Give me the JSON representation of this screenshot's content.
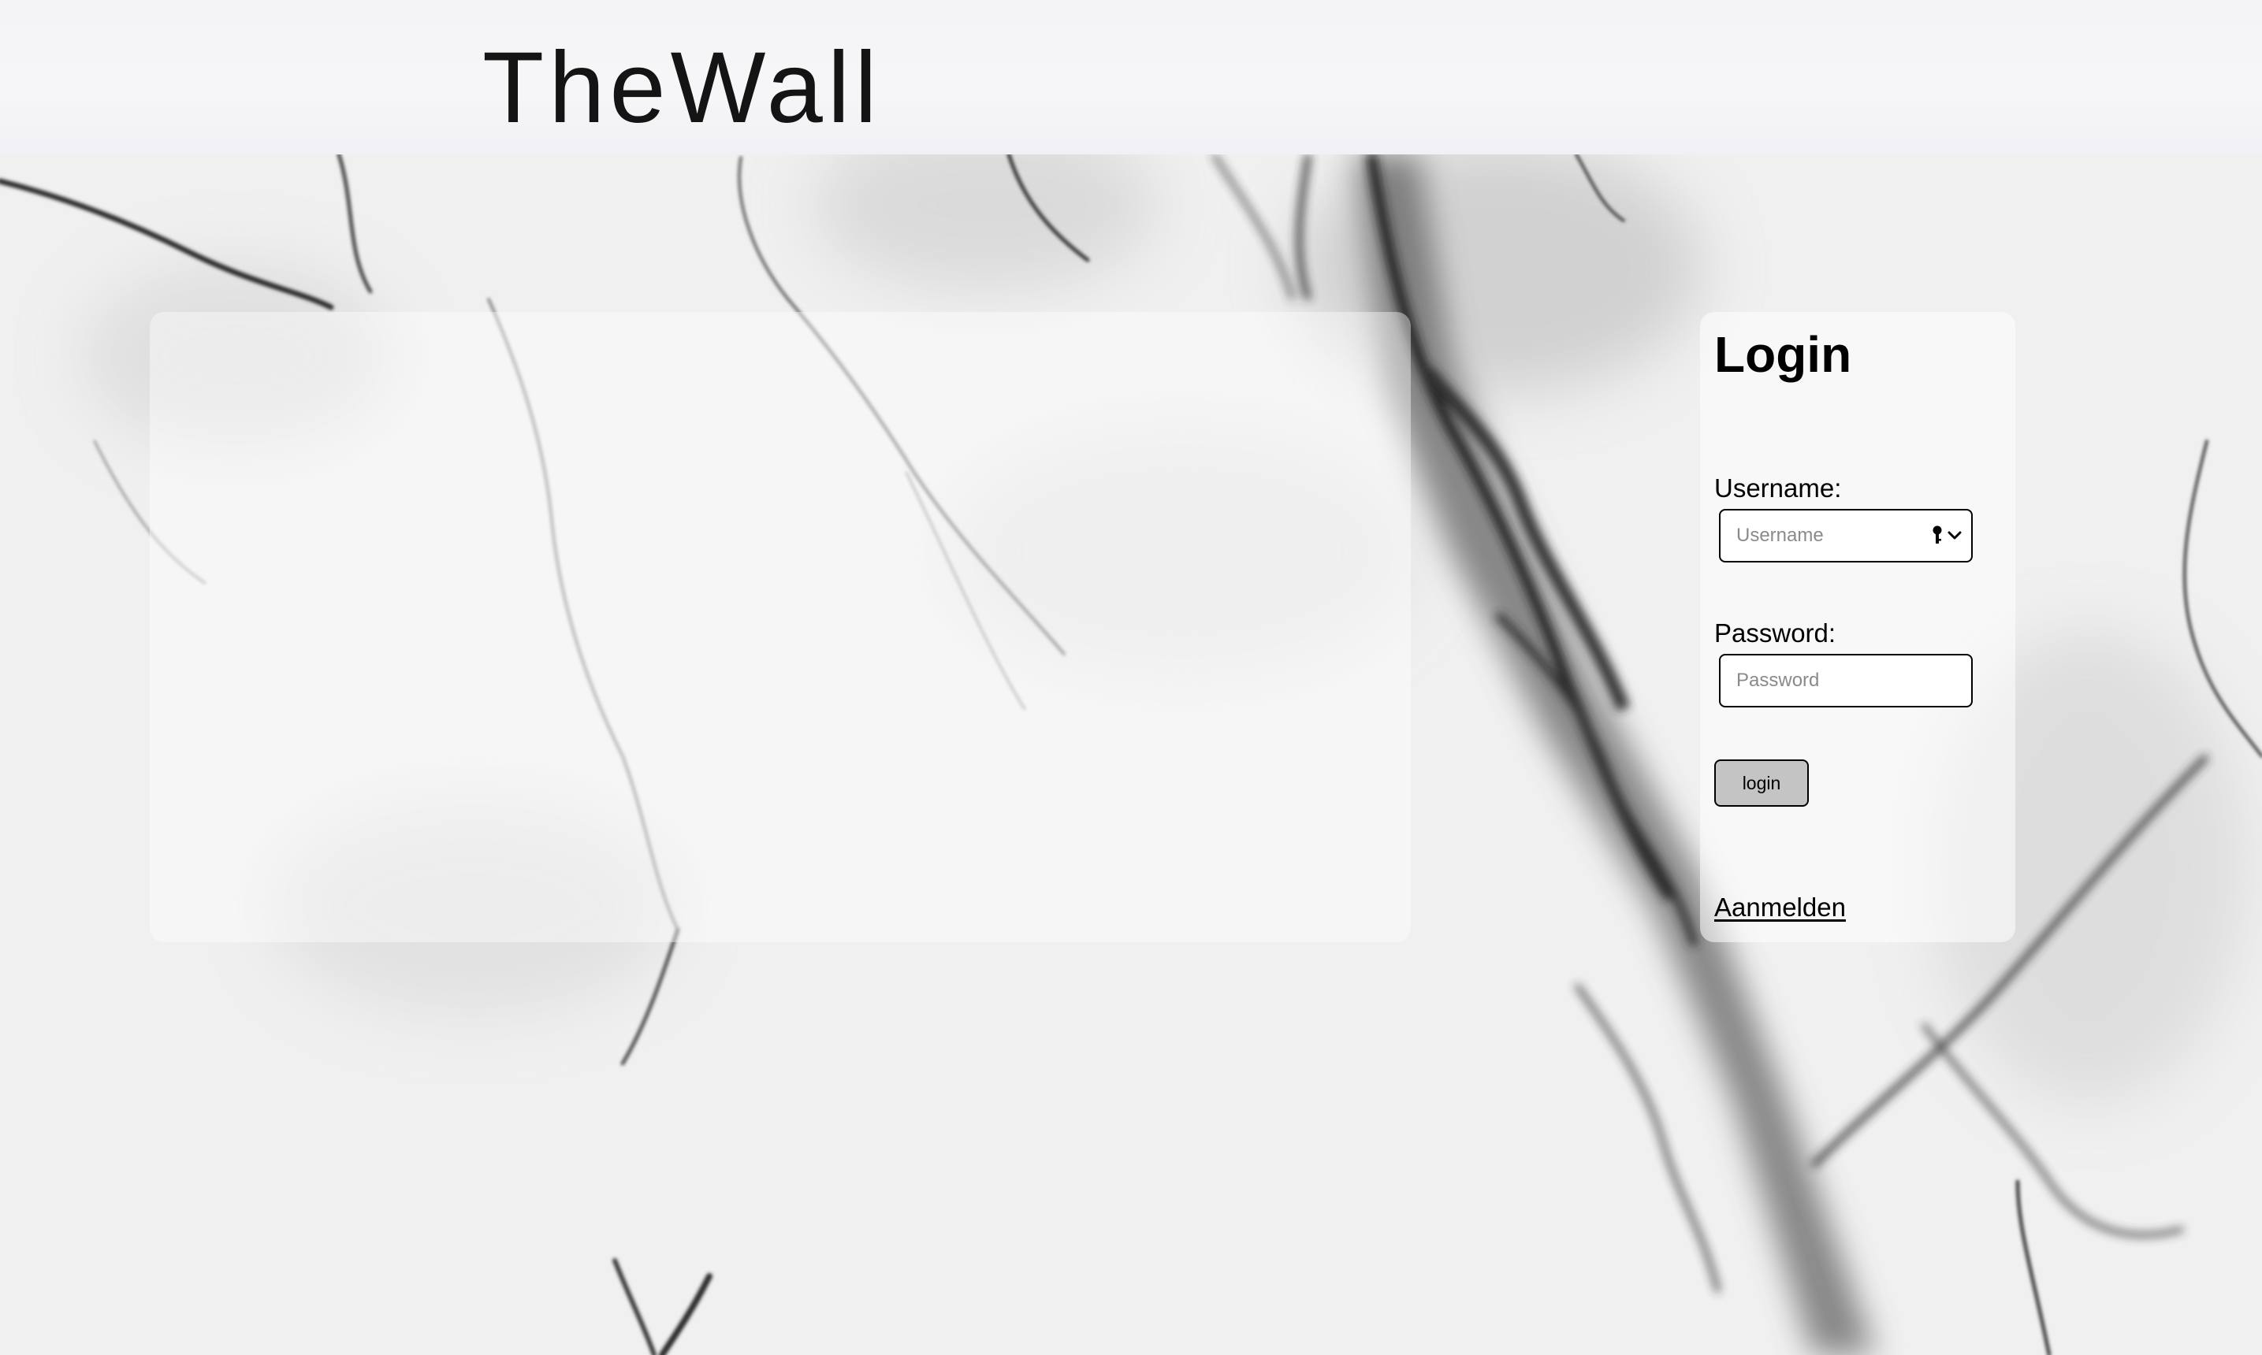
{
  "header": {
    "title": "TheWall"
  },
  "login": {
    "heading": "Login",
    "username_label": "Username:",
    "username_placeholder": "Username",
    "username_value": "",
    "username_autofill_icon": "key-dropdown-icon",
    "password_label": "Password:",
    "password_placeholder": "Password",
    "password_value": "",
    "submit_label": "login",
    "register_link": "Aanmelden"
  },
  "colors": {
    "header_bg": "#f5f5f8",
    "button_bg": "#c4c4c4",
    "text": "#000000",
    "placeholder": "#8a8a8a"
  }
}
